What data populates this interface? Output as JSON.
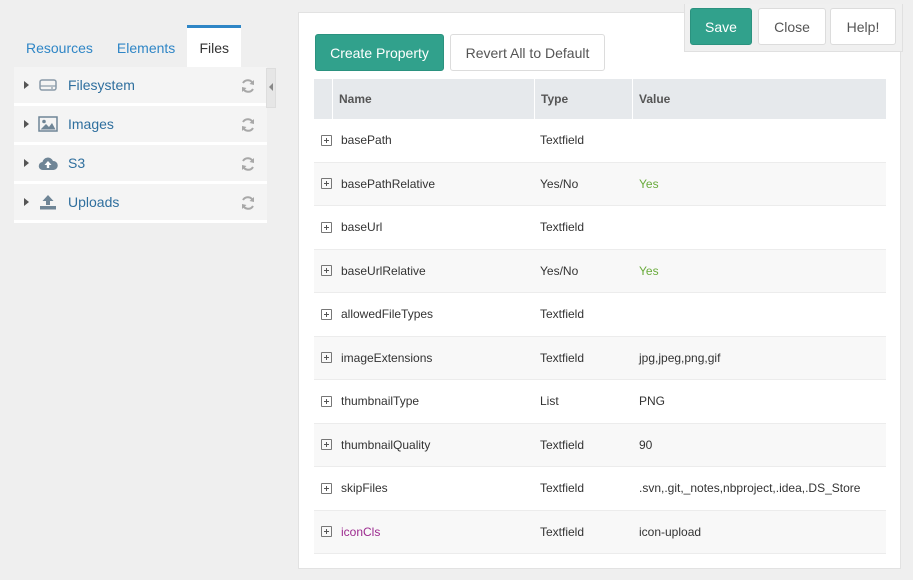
{
  "tabs": [
    "Resources",
    "Elements",
    "Files"
  ],
  "active_tab": "Files",
  "tree": [
    {
      "label": "Filesystem",
      "icon": "hdd-icon"
    },
    {
      "label": "Images",
      "icon": "image-icon"
    },
    {
      "label": "S3",
      "icon": "cloud-upload-icon"
    },
    {
      "label": "Uploads",
      "icon": "upload-icon"
    }
  ],
  "actions": {
    "save": "Save",
    "close": "Close",
    "help": "Help!"
  },
  "toolbar": {
    "create": "Create Property",
    "revert": "Revert All to Default"
  },
  "grid": {
    "headers": {
      "name": "Name",
      "type": "Type",
      "value": "Value"
    },
    "rows": [
      {
        "name": "basePath",
        "type": "Textfield",
        "value": ""
      },
      {
        "name": "basePathRelative",
        "type": "Yes/No",
        "value": "Yes"
      },
      {
        "name": "baseUrl",
        "type": "Textfield",
        "value": ""
      },
      {
        "name": "baseUrlRelative",
        "type": "Yes/No",
        "value": "Yes"
      },
      {
        "name": "allowedFileTypes",
        "type": "Textfield",
        "value": ""
      },
      {
        "name": "imageExtensions",
        "type": "Textfield",
        "value": "jpg,jpeg,png,gif"
      },
      {
        "name": "thumbnailType",
        "type": "List",
        "value": "PNG"
      },
      {
        "name": "thumbnailQuality",
        "type": "Textfield",
        "value": "90"
      },
      {
        "name": "skipFiles",
        "type": "Textfield",
        "value": ".svn,.git,_notes,nbproject,.idea,.DS_Store"
      },
      {
        "name": "iconCls",
        "type": "Textfield",
        "value": "icon-upload"
      }
    ]
  },
  "colors": {
    "accent": "#31a18c",
    "link": "#2f86c6",
    "yes": "#6aab3c",
    "modified": "#9c2a8f"
  }
}
